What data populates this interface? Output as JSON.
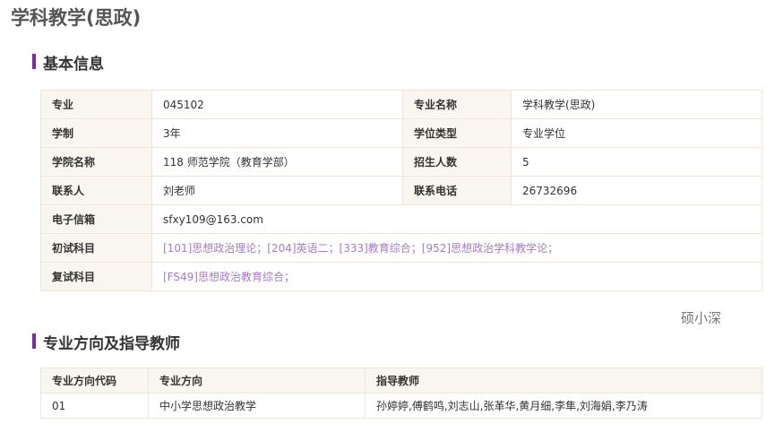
{
  "title": "学科教学(思政)",
  "basic": {
    "heading": "基本信息",
    "major_label": "专业",
    "major": "045102",
    "major_name_label": "专业名称",
    "major_name": "学科教学(思政)",
    "duration_label": "学制",
    "duration": "3年",
    "degree_label": "学位类型",
    "degree": "专业学位",
    "college_label": "学院名称",
    "college": "118 师范学院（教育学部）",
    "enroll_label": "招生人数",
    "enroll": "5",
    "contact_label": "联系人",
    "contact": "刘老师",
    "phone_label": "联系电话",
    "phone": "26732696",
    "email_label": "电子信箱",
    "email": "sfxy109@163.com",
    "prelim_label": "初试科目",
    "prelim": "[101]思想政治理论；[204]英语二；[333]教育综合；[952]思想政治学科教学论；",
    "retest_label": "复试科目",
    "retest": "[FS49]思想政治教育综合；"
  },
  "watermark": "硕小深",
  "directions": {
    "heading": "专业方向及指导教师",
    "headers": [
      "专业方向代码",
      "专业方向",
      "指导教师"
    ],
    "rows": [
      [
        "01",
        "中小学思想政治教学",
        "孙婷婷,傅鹤鸣,刘志山,张革华,黄月细,李隼,刘海娟,李乃涛"
      ]
    ]
  }
}
